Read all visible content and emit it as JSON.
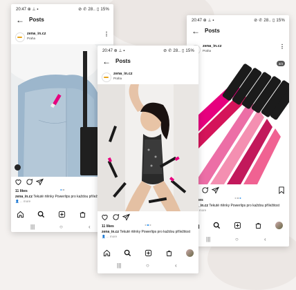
{
  "status": {
    "time": "20:47",
    "right": "⊘ ✆ 28.. ▯ 15%"
  },
  "header": {
    "title": "Posts"
  },
  "author": {
    "username": "zena_in.cz",
    "location": "Praha"
  },
  "post": {
    "likes": "11 likes",
    "caption_user": "zena_in.cz",
    "caption_text": "Tekuté rtěnky Powerlips pro každou příležitost",
    "more": "more",
    "badge": "3/3"
  },
  "colors": {
    "accent": "#3897f0",
    "logo": "#e8a317",
    "lipstick_shades": [
      "#e6007e",
      "#d4145a",
      "#ec6ea6",
      "#f48fb1",
      "#c2185b",
      "#f06292"
    ]
  },
  "icons": [
    "back-arrow-icon",
    "more-vert-icon",
    "heart-icon",
    "comment-icon",
    "share-icon",
    "bookmark-icon",
    "home-icon",
    "search-icon",
    "add-post-icon",
    "shop-icon",
    "profile-avatar"
  ]
}
